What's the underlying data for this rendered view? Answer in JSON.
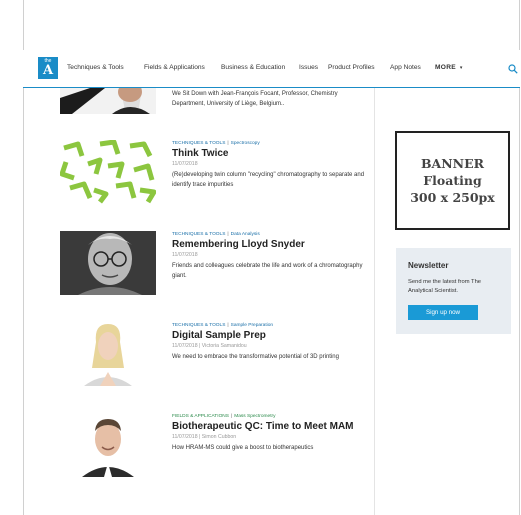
{
  "nav": {
    "logo_small": "the",
    "logo_letter": "A",
    "items": [
      "Techniques & Tools",
      "Fields & Applications",
      "Business & Education",
      "Issues",
      "Product Profiles",
      "App Notes"
    ],
    "more_label": "MORE",
    "search_icon": "search-icon",
    "accent_color": "#1a8cc7"
  },
  "articles": [
    {
      "excerpt": "We Sit Down with Jean-François Focant, Professor, Chemistry Department, University of Liège, Belgium.."
    },
    {
      "category": "TECHNIQUES & TOOLS",
      "subcategory": "Spectroscopy",
      "title": "Think Twice",
      "date": "11/07/2018",
      "excerpt": "(Re)developing twin column \"recycling\" chromatography to separate and identify trace impurities"
    },
    {
      "category": "TECHNIQUES & TOOLS",
      "subcategory": "Data Analysis",
      "title": "Remembering Lloyd Snyder",
      "date": "11/07/2018",
      "excerpt": "Friends and colleagues celebrate the life and work of a chromatography giant."
    },
    {
      "category": "TECHNIQUES & TOOLS",
      "subcategory": "Sample Preparation",
      "title": "Digital Sample Prep",
      "date": "11/07/2018 | Victoria Samanidou",
      "excerpt": "We need to embrace the transformative potential of 3D printing"
    },
    {
      "category": "FIELDS & APPLICATIONS",
      "subcategory": "Mass Spectrometry",
      "title": "Biotherapeutic QC: Time to Meet MAM",
      "date": "11/07/2018 | Simon Cubbon",
      "excerpt": "How HRAM-MS could give a boost to biotherapeutics"
    }
  ],
  "sidebar": {
    "banner": {
      "line1": "BANNER",
      "line2": "Floating",
      "line3": "300 x 250px"
    },
    "newsletter": {
      "title": "Newsletter",
      "text": "Send me the latest from The Analytical Scientist.",
      "button": "Sign up now",
      "button_color": "#1a9ad6"
    }
  }
}
